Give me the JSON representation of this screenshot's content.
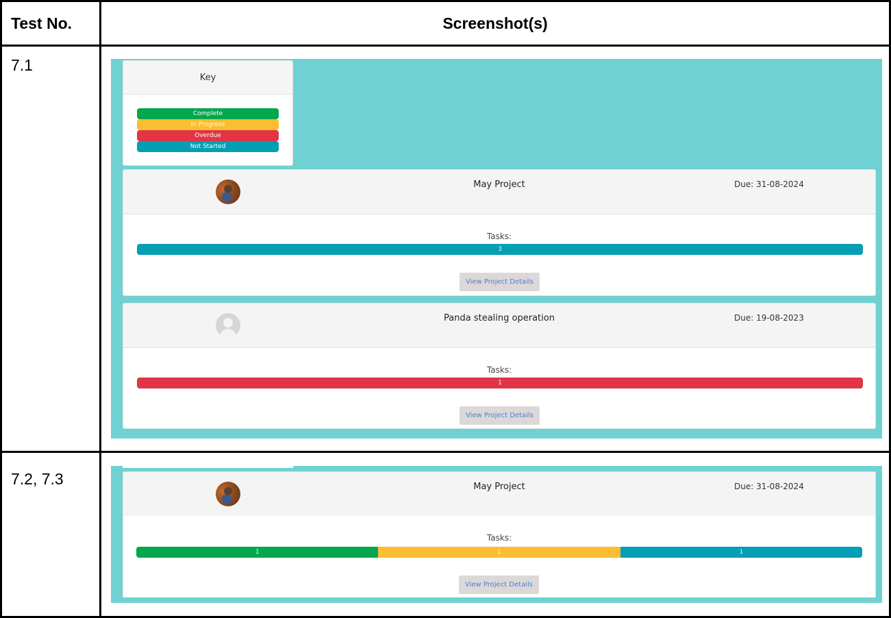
{
  "table": {
    "header": {
      "test_no": "Test No.",
      "screenshots": "Screenshot(s)"
    },
    "rows": [
      {
        "test_no": "7.1"
      },
      {
        "test_no": "7.2, 7.3"
      }
    ]
  },
  "key": {
    "title": "Key",
    "items": [
      {
        "label": "Complete",
        "color": "#04a74d"
      },
      {
        "label": "In Progress",
        "color": "#fbbd31"
      },
      {
        "label": "Overdue",
        "color": "#e13545"
      },
      {
        "label": "Not Started",
        "color": "#049fb4"
      }
    ]
  },
  "colors": {
    "background": "#6fd1d2"
  },
  "shot1": {
    "projects": [
      {
        "title": "May Project",
        "due": "Due: 31-08-2024",
        "avatar": "user-photo",
        "tasks_label": "Tasks:",
        "segments": [
          {
            "status": "Not Started",
            "value": "3",
            "color": "#049fb4"
          }
        ],
        "button": "View Project Details"
      },
      {
        "title": "Panda stealing operation",
        "due": "Due: 19-08-2023",
        "avatar": "default-user-icon",
        "tasks_label": "Tasks:",
        "segments": [
          {
            "status": "Overdue",
            "value": "1",
            "color": "#e13545"
          }
        ],
        "button": "View Project Details"
      }
    ]
  },
  "shot2": {
    "project": {
      "title": "May Project",
      "due": "Due: 31-08-2024",
      "avatar": "user-photo",
      "tasks_label": "Tasks:",
      "segments": [
        {
          "status": "Complete",
          "value": "1",
          "color": "#04a74d"
        },
        {
          "status": "In Progress",
          "value": "1",
          "color": "#fbbd31"
        },
        {
          "status": "Not Started",
          "value": "1",
          "color": "#049fb4"
        }
      ],
      "button": "View Project Details"
    }
  }
}
